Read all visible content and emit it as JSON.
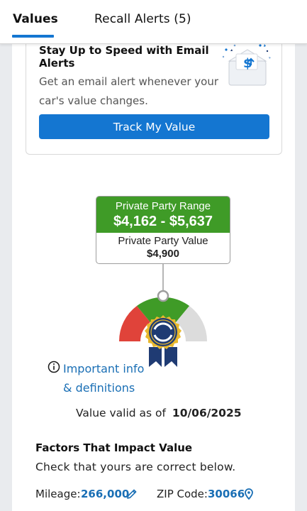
{
  "tabs": {
    "values_label": "Values",
    "recall_label": "Recall Alerts (5)"
  },
  "email_alert": {
    "title": "Stay Up to Speed with Email Alerts",
    "description": "Get an email alert whenever your car's value changes.",
    "button_label": "Track My Value"
  },
  "valuation": {
    "range_label": "Private Party Range",
    "range_value": "$4,162 - $5,637",
    "value_label": "Private Party Value",
    "value": "$4,900"
  },
  "info": {
    "line1": "Important info",
    "line2": "& definitions"
  },
  "validity": {
    "label": "Value valid as of",
    "date": "10/06/2025"
  },
  "factors": {
    "title": "Factors That Impact Value",
    "subtitle": "Check that yours are correct below.",
    "mileage_label": "Mileage:",
    "mileage_value": "266,000",
    "zip_label": "ZIP Code:",
    "zip_value": "30066"
  },
  "colors": {
    "accent_blue": "#1476d1",
    "range_green": "#3f9b27",
    "gauge_red": "#e0433a",
    "gauge_gray": "#dcdcdc",
    "badge_navy": "#1f3b73",
    "badge_gold": "#e8b82e"
  },
  "icons": [
    "envelope-dollar-icon",
    "info-icon",
    "pencil-icon",
    "location-pin-icon",
    "kbb-badge-icon"
  ]
}
